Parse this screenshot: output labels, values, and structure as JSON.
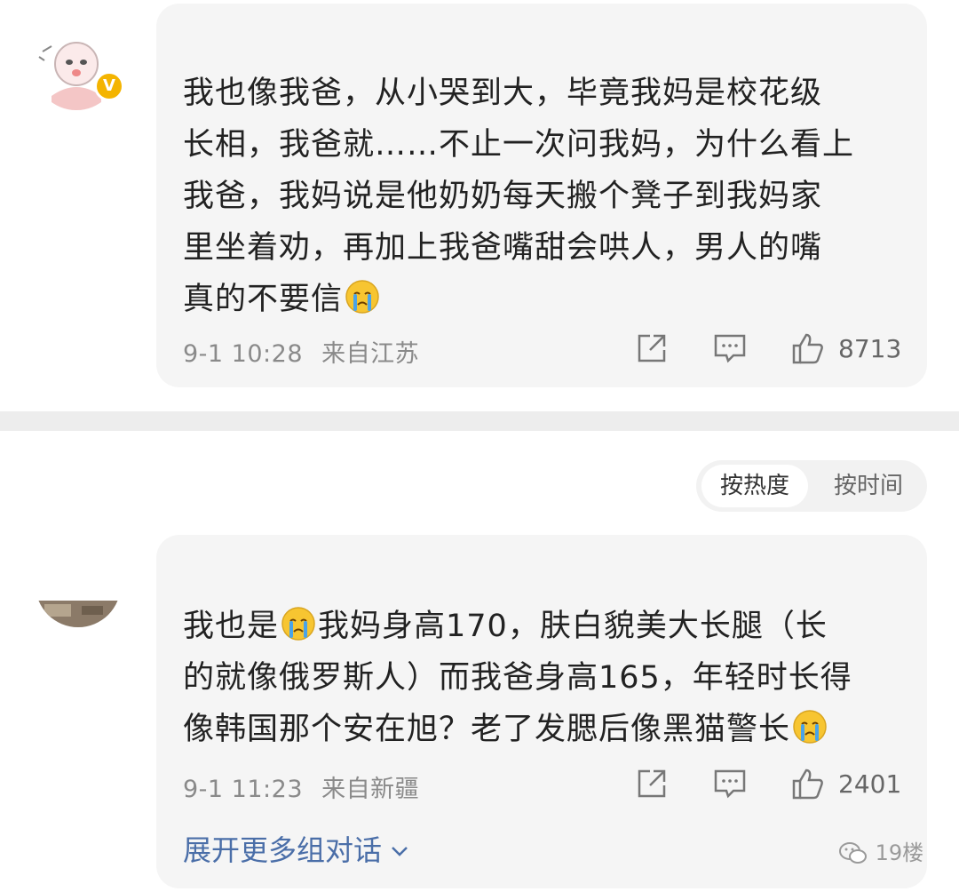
{
  "comments": [
    {
      "text_parts": [
        "我也像我爸，从小哭到大，毕竟我妈是校花级\n长相，我爸就……不止一次问我妈，为什么看上\n我爸，我妈说是他奶奶每天搬个凳子到我妈家\n里坐着劝，再加上我爸嘴甜会哄人，男人的嘴\n真的不要信",
        ""
      ],
      "time": "9-1 10:28",
      "location": "来自江苏",
      "likes": "8713",
      "verified_badge": "V"
    },
    {
      "text_parts": [
        "我也是",
        "我妈身高170，肤白貌美大长腿（长\n的就像俄罗斯人）而我爸身高165，年轻时长得\n像韩国那个安在旭？老了发腮后像黑猫警长",
        ""
      ],
      "time": "9-1 11:23",
      "location": "来自新疆",
      "likes": "2401"
    }
  ],
  "sort": {
    "by_heat": "按热度",
    "by_time": "按时间"
  },
  "expand_label": "展开更多组对话",
  "watermark": "19楼",
  "colors": {
    "bubble": "#f5f5f5",
    "link": "#4a6ea8",
    "meta": "#8a8a8a",
    "badge": "#f4b400"
  },
  "icons": [
    "repost-icon",
    "comment-icon",
    "like-icon",
    "crying-emoji",
    "verified-badge-icon",
    "chevron-down-icon",
    "wechat-icon"
  ]
}
